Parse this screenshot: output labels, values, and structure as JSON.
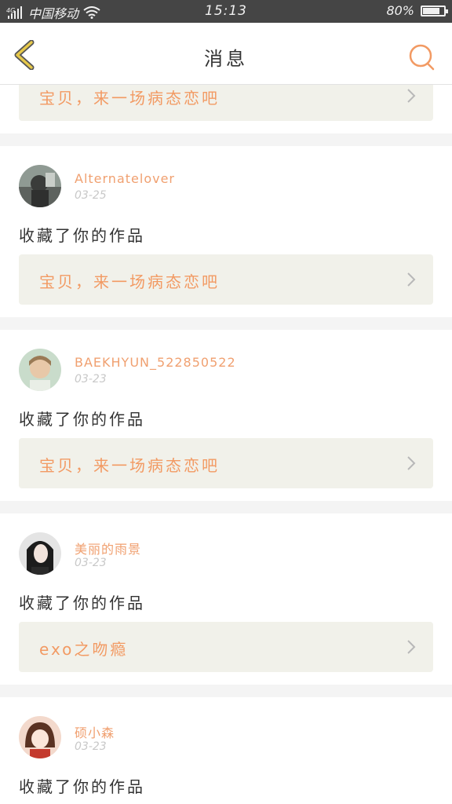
{
  "status_bar": {
    "network": "4G",
    "carrier": "中国移动",
    "time": "15:13",
    "battery": "80%",
    "battery_level": 0.8
  },
  "header": {
    "title": "消息",
    "back_icon": "chevron-left-icon",
    "search_icon": "search-icon"
  },
  "colors": {
    "accent": "#f29a63",
    "back_icon": "#e6c84a",
    "link_bg": "#f1f1ea"
  },
  "messages": [
    {
      "work_title": "宝贝，来一场病态恋吧"
    },
    {
      "username": "Alternatelover",
      "date": "03-25",
      "action": "收藏了你的作品",
      "work_title": "宝贝，来一场病态恋吧"
    },
    {
      "username": "BAEKHYUN_522850522",
      "date": "03-23",
      "action": "收藏了你的作品",
      "work_title": "宝贝，来一场病态恋吧"
    },
    {
      "username": "美丽的雨景",
      "date": "03-23",
      "action": "收藏了你的作品",
      "work_title": "exo之吻瘾"
    },
    {
      "username": "硕小森",
      "date": "03-23",
      "action": "收藏了你的作品"
    }
  ]
}
